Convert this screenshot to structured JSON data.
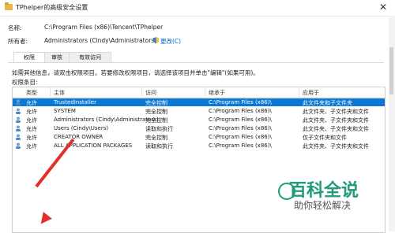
{
  "window": {
    "title": "TPhelper的高级安全设置",
    "close_glyph": "✕"
  },
  "info": {
    "name_label": "名称:",
    "name_value": "C:\\Program Files (x86)\\Tencent\\TPhelper",
    "owner_label": "所有者:",
    "owner_value": "Administrators (Cindy\\Administrators)",
    "change_link": "更改(C)"
  },
  "tabs": [
    {
      "label": "权限",
      "active": true
    },
    {
      "label": "审核",
      "active": false
    },
    {
      "label": "有效访问",
      "active": false
    }
  ],
  "description": "如需其他信息，请双击权限项目。若要修改权限项目，请选择该项目并单击\"编辑\"(如果可用)。",
  "entries_label": "权限条目:",
  "table": {
    "headers": [
      "类型",
      "主体",
      "访问",
      "继承于",
      "应用于"
    ],
    "rows": [
      {
        "type": "允许",
        "principal": "TrustedInstaller",
        "access": "完全控制",
        "inherited": "C:\\Program Files (x86)\\",
        "applies": "此文件夹和子文件夹",
        "selected": true
      },
      {
        "type": "允许",
        "principal": "SYSTEM",
        "access": "完全控制",
        "inherited": "C:\\Program Files (x86)\\",
        "applies": "此文件夹、子文件夹和文件",
        "selected": false
      },
      {
        "type": "允许",
        "principal": "Administrators (Cindy\\Administrators)",
        "access": "完全控制",
        "inherited": "C:\\Program Files (x86)\\",
        "applies": "此文件夹、子文件夹和文件",
        "selected": false
      },
      {
        "type": "允许",
        "principal": "Users (Cindy\\Users)",
        "access": "读取和执行",
        "inherited": "C:\\Program Files (x86)\\",
        "applies": "此文件夹、子文件夹和文件",
        "selected": false
      },
      {
        "type": "允许",
        "principal": "CREATOR OWNER",
        "access": "完全控制",
        "inherited": "C:\\Program Files (x86)\\",
        "applies": "仅子文件夹和文件",
        "selected": false
      },
      {
        "type": "允许",
        "principal": "ALL APPLICATION PACKAGES",
        "access": "读取和执行",
        "inherited": "C:\\Program Files (x86)\\",
        "applies": "此文件夹、子文件夹和文件",
        "selected": false
      }
    ]
  },
  "watermark": {
    "title": "百科全说",
    "subtitle": "助你轻松解决"
  },
  "colors": {
    "selection": "#0a78d7",
    "arrow": "#e0312f",
    "watermark": "#1f9b7a",
    "link": "#0066cc"
  }
}
